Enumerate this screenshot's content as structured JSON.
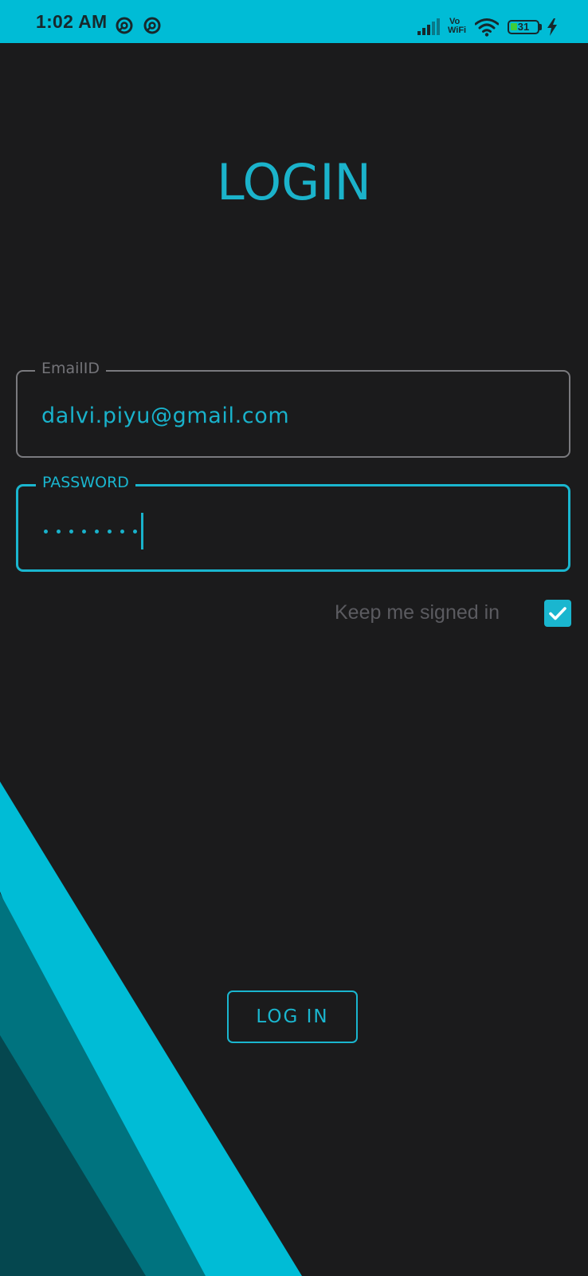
{
  "status_bar": {
    "time": "1:02 AM",
    "vo_label": "Vo",
    "wifi_label": "WiFi",
    "battery_level": "31",
    "notification_icons": [
      "at-sign-icon",
      "at-sign-icon"
    ],
    "icons": [
      "signal-icon",
      "vowifi-icon",
      "wifi-icon",
      "battery-icon",
      "charging-bolt-icon"
    ],
    "background_color": "#00bcd6"
  },
  "login": {
    "title": "LOGIN",
    "email_label": "EmailID",
    "email_value": "dalvi.piyu@gmail.com",
    "password_label": "PASSWORD",
    "password_masked_length": 8,
    "keep_signed_in_label": "Keep me signed in",
    "keep_signed_in_checked": true,
    "login_button_label": "LOG IN"
  },
  "colors": {
    "accent": "#1ab6cf",
    "background": "#1b1b1c",
    "stripe_light": "#00bcd6",
    "stripe_mid": "#00737f",
    "stripe_dark": "#05474f",
    "muted_text": "#5b5b60"
  }
}
